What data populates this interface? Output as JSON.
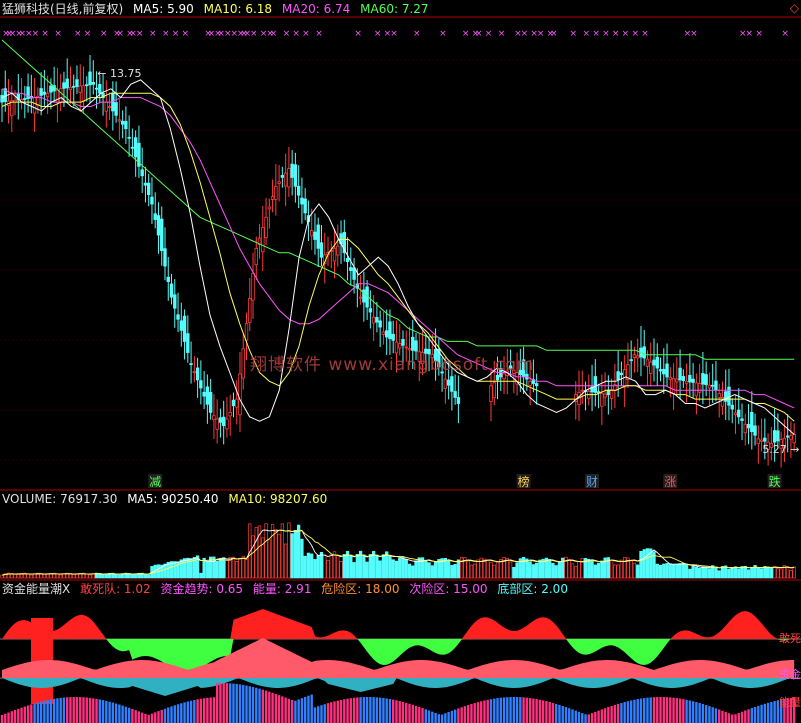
{
  "header": {
    "title": "猛狮科技(日线,前复权)",
    "ma5": "MA5: 5.90",
    "ma10": "MA10: 6.18",
    "ma20": "MA20: 6.74",
    "ma60": "MA60: 7.27"
  },
  "volume_header": {
    "title": "VOLUME: 76917.30",
    "ma5": "MA5: 90250.40",
    "ma10": "MA10: 98207.60"
  },
  "indicator_header": {
    "title": "资金能量潮X",
    "dsd": "敢死队: 1.02",
    "trend": "资金趋势: 0.65",
    "energy": "能量: 2.91",
    "danger": "危险区: 18.00",
    "sub_danger": "次险区: 15.00",
    "bottom": "底部区: 2.00"
  },
  "watermark": "翔博软件  www.xiangbosoft.com",
  "corner_icon": "◇",
  "colors": {
    "up": "#ff3c3c",
    "down": "#54fcfc",
    "ma5": "#ffffff",
    "ma10": "#ffff54",
    "ma20": "#ff54ff",
    "ma60": "#54ff54",
    "grid": "#800000",
    "axis": "#b00000"
  },
  "chart_data": [
    {
      "type": "candlestick",
      "title": "猛狮科技(日线,前复权)",
      "ylim": [
        4.8,
        14.5
      ],
      "annotations": [
        {
          "label": "13.75",
          "bar": 28,
          "value": 13.75
        },
        {
          "label": "5.27",
          "bar": 232,
          "value": 5.27
        }
      ],
      "event_labels": [
        {
          "text": "减",
          "bar": 47,
          "color": "#54ff54"
        },
        {
          "text": "榜",
          "bar": 160,
          "color": "#ffd050"
        },
        {
          "text": "财",
          "bar": 181,
          "color": "#54a0ff"
        },
        {
          "text": "涨",
          "bar": 205,
          "color": "#ff5050"
        },
        {
          "text": "跌",
          "bar": 237,
          "color": "#54ff54"
        }
      ],
      "signal_marks": [
        1,
        2,
        3,
        5,
        6,
        8,
        10,
        13,
        17,
        23,
        26,
        31,
        35,
        36,
        39,
        40,
        42,
        46,
        50,
        53,
        56,
        63,
        64,
        66,
        67,
        69,
        71,
        73,
        74,
        75,
        77,
        80,
        82,
        83,
        87,
        90,
        93,
        97,
        109,
        115,
        118,
        120,
        127,
        135,
        142,
        145,
        146,
        149,
        153,
        158,
        160,
        163,
        165,
        168,
        169,
        175,
        179,
        182,
        185,
        188,
        191,
        194,
        197,
        210,
        212,
        227,
        229,
        232,
        240
      ],
      "ma5": [
        13.2,
        13.3,
        13.1,
        13.0,
        12.9,
        13.1,
        13.2,
        13.0,
        12.9,
        13.1,
        13.3,
        13.4,
        13.2,
        13.5,
        13.6,
        13.4,
        13.2,
        12.5,
        11.6,
        10.6,
        9.4,
        8.3,
        7.6,
        7.0,
        6.4,
        6.0,
        5.9,
        6.0,
        6.6,
        8.0,
        9.6,
        10.5,
        10.8,
        10.5,
        10.0,
        9.6,
        9.2,
        9.4,
        9.6,
        9.4,
        9.0,
        8.5,
        8.1,
        7.8,
        7.5,
        7.2,
        7.0,
        6.9,
        6.8,
        6.9,
        7.1,
        7.0,
        6.8,
        6.5,
        6.3,
        6.2,
        6.1,
        6.2,
        6.4,
        6.6,
        6.7,
        6.8,
        6.8,
        6.9,
        6.8,
        6.5,
        6.5,
        6.6,
        6.5,
        6.3,
        6.3,
        6.2,
        6.3,
        6.4,
        6.5,
        6.4,
        6.3,
        6.2,
        6.0,
        5.8,
        5.6
      ],
      "ma10": [
        13.0,
        13.1,
        13.1,
        13.1,
        13.0,
        13.0,
        13.1,
        13.1,
        13.1,
        13.2,
        13.2,
        13.3,
        13.3,
        13.3,
        13.3,
        13.3,
        13.2,
        13.0,
        12.6,
        12.0,
        11.3,
        10.5,
        9.7,
        8.8,
        8.1,
        7.5,
        7.0,
        6.8,
        6.7,
        7.0,
        7.6,
        8.5,
        9.2,
        9.7,
        10.0,
        10.0,
        9.8,
        9.5,
        9.2,
        9.0,
        8.7,
        8.4,
        8.1,
        7.9,
        7.6,
        7.3,
        7.1,
        6.9,
        6.8,
        6.8,
        6.8,
        6.8,
        6.8,
        6.7,
        6.6,
        6.5,
        6.4,
        6.4,
        6.4,
        6.5,
        6.5,
        6.6,
        6.6,
        6.7,
        6.7,
        6.6,
        6.6,
        6.6,
        6.5,
        6.5,
        6.4,
        6.4,
        6.4,
        6.4,
        6.4,
        6.4,
        6.3,
        6.3,
        6.2,
        6.1,
        5.9
      ],
      "ma20": [
        13.4,
        13.3,
        13.3,
        13.2,
        13.2,
        13.1,
        13.1,
        13.1,
        13.0,
        13.0,
        13.1,
        13.1,
        13.2,
        13.2,
        13.2,
        13.1,
        13.0,
        12.8,
        12.5,
        12.2,
        11.8,
        11.3,
        10.8,
        10.3,
        9.8,
        9.4,
        9.0,
        8.7,
        8.4,
        8.2,
        8.1,
        8.1,
        8.2,
        8.4,
        8.6,
        8.8,
        9.0,
        9.0,
        8.9,
        8.8,
        8.6,
        8.4,
        8.2,
        8.0,
        7.8,
        7.6,
        7.4,
        7.3,
        7.2,
        7.1,
        7.0,
        7.0,
        6.9,
        6.9,
        6.8,
        6.8,
        6.7,
        6.7,
        6.7,
        6.7,
        6.7,
        6.7,
        6.7,
        6.7,
        6.7,
        6.7,
        6.7,
        6.7,
        6.6,
        6.6,
        6.6,
        6.6,
        6.6,
        6.6,
        6.6,
        6.6,
        6.5,
        6.5,
        6.4,
        6.3,
        6.2
      ],
      "ma60": [
        14.5,
        14.3,
        14.1,
        13.9,
        13.7,
        13.5,
        13.3,
        13.1,
        12.9,
        12.7,
        12.5,
        12.3,
        12.1,
        11.9,
        11.7,
        11.5,
        11.3,
        11.1,
        10.9,
        10.7,
        10.5,
        10.4,
        10.3,
        10.2,
        10.1,
        10.0,
        9.9,
        9.8,
        9.7,
        9.7,
        9.6,
        9.5,
        9.4,
        9.3,
        9.2,
        9.0,
        8.9,
        8.7,
        8.5,
        8.3,
        8.2,
        8.0,
        7.9,
        7.8,
        7.8,
        7.7,
        7.7,
        7.7,
        7.6,
        7.6,
        7.6,
        7.6,
        7.6,
        7.6,
        7.6,
        7.5,
        7.5,
        7.5,
        7.5,
        7.5,
        7.5,
        7.5,
        7.5,
        7.5,
        7.5,
        7.4,
        7.4,
        7.4,
        7.4,
        7.4,
        7.4,
        7.3,
        7.3,
        7.3,
        7.3,
        7.3,
        7.3,
        7.3,
        7.3,
        7.3,
        7.3
      ]
    },
    {
      "type": "bar",
      "title": "VOLUME: 76917.30",
      "ylim": [
        0,
        150000
      ],
      "ma5_last": 90250.4,
      "ma10_last": 98207.6
    },
    {
      "type": "area",
      "title": "资金能量潮X",
      "series": [
        {
          "name": "敢死队",
          "last": 1.02
        },
        {
          "name": "资金趋势",
          "last": 0.65
        },
        {
          "name": "能量",
          "last": 2.91
        }
      ],
      "levels": [
        {
          "name": "危险区",
          "value": 18.0
        },
        {
          "name": "次险区",
          "value": 15.0
        },
        {
          "name": "底部区",
          "value": 2.0
        }
      ],
      "right_labels": [
        "敢死",
        "资金",
        "能量"
      ]
    }
  ]
}
